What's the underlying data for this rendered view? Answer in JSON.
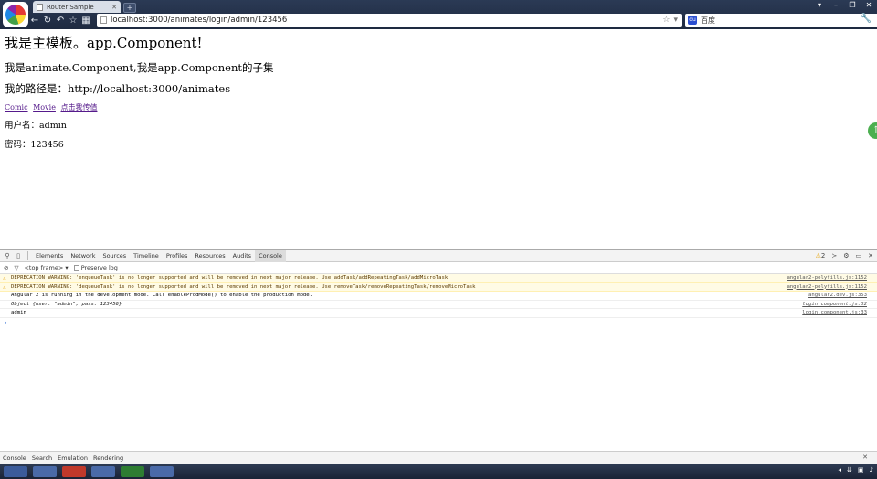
{
  "browser": {
    "tab_title": "Router Sample",
    "url": "localhost:3000/animates/login/admin/123456",
    "search_placeholder": "百度",
    "accent": "#2b3a55"
  },
  "page": {
    "heading": "我是主模板。app.Component!",
    "subheading": "我是animate.Component,我是app.Component的子集",
    "path_line": "我的路径是：http://localhost:3000/animates",
    "links": [
      "Comic",
      "Movie",
      "点击我传值"
    ],
    "username_line": "用户名：admin",
    "password_line": "密码：123456"
  },
  "devtools": {
    "tabs": [
      "Elements",
      "Network",
      "Sources",
      "Timeline",
      "Profiles",
      "Resources",
      "Audits",
      "Console"
    ],
    "active_tab": "Console",
    "warning_count": "2",
    "frame_selector": "<top frame>",
    "preserve_log": "Preserve log",
    "logs": [
      {
        "type": "warning",
        "text": "DEPRECATION WARNING: 'enqueueTask' is no longer supported and will be removed in next major release. Use addTask/addRepeatingTask/addMicroTask",
        "src": "angular2-polyfills.js:1152"
      },
      {
        "type": "warning",
        "text": "DEPRECATION WARNING: 'dequeueTask' is no longer supported and will be removed in next major release. Use removeTask/removeRepeatingTask/removeMicroTask",
        "src": "angular2-polyfills.js:1152"
      },
      {
        "type": "info",
        "text": "Angular 2 is running in the development mode. Call enableProdMode() to enable the production mode.",
        "src": "angular2.dev.js:353"
      },
      {
        "type": "object",
        "text": "Object {user: \"admin\", pass: 123456}",
        "src": "login.component.js:32"
      },
      {
        "type": "info",
        "text": "admin",
        "src": "login.component.js:33"
      }
    ],
    "prompt": "›",
    "drawer_tabs": [
      "Console",
      "Search",
      "Emulation",
      "Rendering"
    ]
  }
}
